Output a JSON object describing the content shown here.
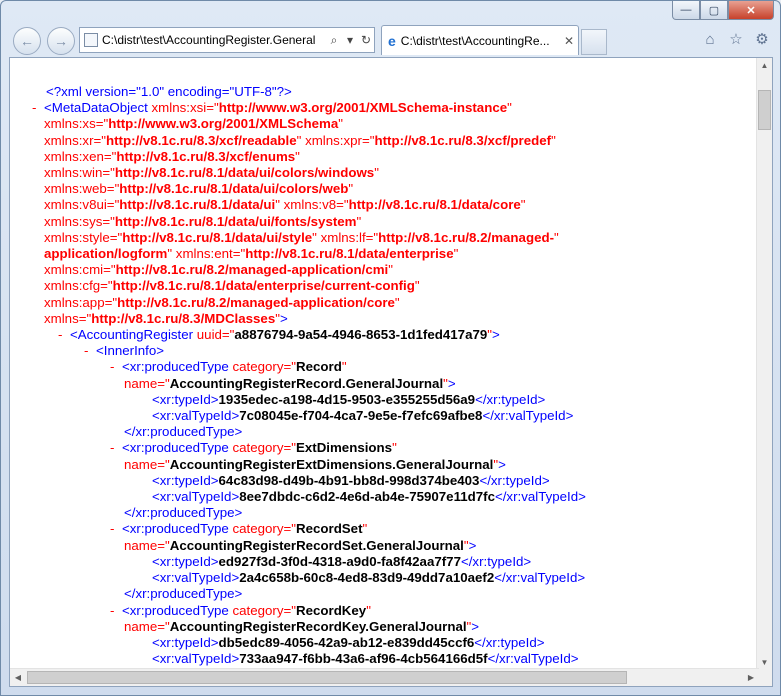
{
  "window": {
    "minimize": "—",
    "maximize": "▢",
    "close": "✕"
  },
  "nav": {
    "back_icon": "arrow-left",
    "forward_icon": "arrow-right"
  },
  "address": {
    "url": "C:\\distr\\test\\AccountingRegister.General",
    "search_glyph": "⌕",
    "dropdown_glyph": "▾",
    "refresh_glyph": "↻"
  },
  "tab": {
    "title": "C:\\distr\\test\\AccountingRe...",
    "close_glyph": "✕"
  },
  "toolbar": {
    "home_glyph": "⌂",
    "favorites_glyph": "☆",
    "tools_glyph": "⚙"
  },
  "xml": {
    "decl": "<?xml version=\"1.0\" encoding=\"UTF-8\"?>",
    "root_attrs": [
      [
        "xmlns:xsi",
        "http://www.w3.org/2001/XMLSchema-instance"
      ],
      [
        "xmlns:xs",
        "http://www.w3.org/2001/XMLSchema"
      ],
      [
        "xmlns:xr",
        "http://v8.1c.ru/8.3/xcf/readable"
      ],
      [
        "xmlns:xpr",
        "http://v8.1c.ru/8.3/xcf/predef"
      ],
      [
        "xmlns:xen",
        "http://v8.1c.ru/8.3/xcf/enums"
      ],
      [
        "xmlns:win",
        "http://v8.1c.ru/8.1/data/ui/colors/windows"
      ],
      [
        "xmlns:web",
        "http://v8.1c.ru/8.1/data/ui/colors/web"
      ],
      [
        "xmlns:v8ui",
        "http://v8.1c.ru/8.1/data/ui"
      ],
      [
        "xmlns:v8",
        "http://v8.1c.ru/8.1/data/core"
      ],
      [
        "xmlns:sys",
        "http://v8.1c.ru/8.1/data/ui/fonts/system"
      ],
      [
        "xmlns:style",
        "http://v8.1c.ru/8.1/data/ui/style"
      ],
      [
        "xmlns:lf",
        "http://v8.1c.ru/8.2/managed-"
      ],
      [
        "xmlns:ent",
        "http://v8.1c.ru/8.1/data/enterprise"
      ],
      [
        "xmlns:cmi",
        "http://v8.1c.ru/8.2/managed-application/cmi"
      ],
      [
        "xmlns:cfg",
        "http://v8.1c.ru/8.1/data/enterprise/current-config"
      ],
      [
        "xmlns:app",
        "http://v8.1c.ru/8.2/managed-application/core"
      ],
      [
        "xmlns",
        "http://v8.1c.ru/8.3/MDClasses"
      ]
    ],
    "lf_continuation": "application/logform",
    "register_uuid": "a8876794-9a54-4946-8653-1d1fed417a79",
    "produced_types": [
      {
        "category": "Record",
        "name": "AccountingRegisterRecord.GeneralJournal",
        "typeId": "1935edec-a198-4d15-9503-e355255d56a9",
        "valTypeId": "7c08045e-f704-4ca7-9e5e-f7efc69afbe8"
      },
      {
        "category": "ExtDimensions",
        "name": "AccountingRegisterExtDimensions.GeneralJournal",
        "typeId": "64c83d98-d49b-4b91-bb8d-998d374be403",
        "valTypeId": "8ee7dbdc-c6d2-4e6d-ab4e-75907e11d7fc"
      },
      {
        "category": "RecordSet",
        "name": "AccountingRegisterRecordSet.GeneralJournal",
        "typeId": "ed927f3d-3f0d-4318-a9d0-fa8f42aa7f77",
        "valTypeId": "2a4c658b-60c8-4ed8-83d9-49dd7a10aef2"
      },
      {
        "category": "RecordKey",
        "name": "AccountingRegisterRecordKey.GeneralJournal",
        "typeId": "db5edc89-4056-42a9-ab12-e839dd45ccf6",
        "valTypeId": "733aa947-f6bb-43a6-af96-4cb564166d5f"
      }
    ],
    "labels": {
      "minus": "-",
      "meta_open": "<MetaDataObject",
      "acc_open": "<AccountingRegister",
      "uuid_attr": "uuid",
      "inner_open": "<InnerInfo>",
      "pt_open": "<xr:producedType",
      "category_attr": "category",
      "name_attr": "name",
      "tag_close": ">",
      "typeid_open": "<xr:typeId>",
      "typeid_close": "</xr:typeId>",
      "valtypeid_open": "<xr:valTypeId>",
      "valtypeid_close": "</xr:valTypeId>",
      "pt_close": "</xr:producedType>"
    }
  }
}
